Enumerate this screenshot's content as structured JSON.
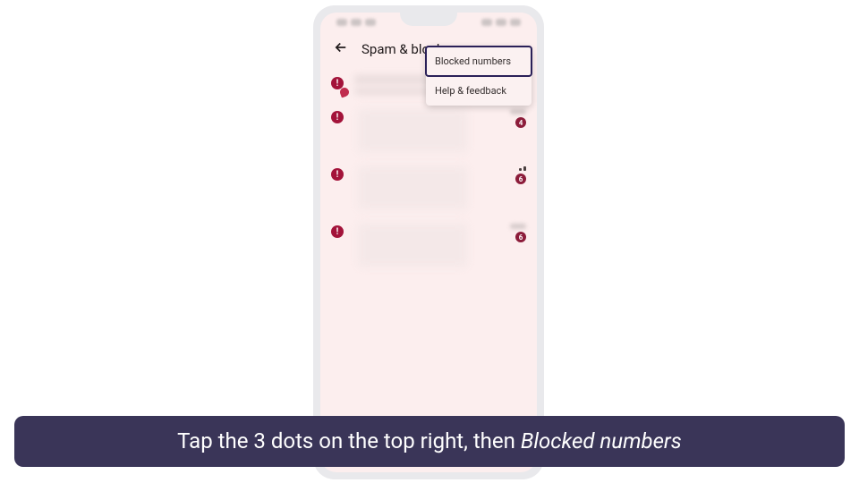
{
  "header": {
    "title": "Spam & block"
  },
  "dropdown": {
    "items": [
      {
        "label": "Blocked numbers",
        "highlighted": true
      },
      {
        "label": "Help & feedback",
        "highlighted": false
      }
    ]
  },
  "list": {
    "items": [
      {
        "has_bubble": true,
        "style": "lines",
        "count": "",
        "signal": false
      },
      {
        "has_bubble": false,
        "style": "block",
        "count": "4",
        "signal": false
      },
      {
        "has_bubble": false,
        "style": "block",
        "count": "6",
        "signal": true
      },
      {
        "has_bubble": false,
        "style": "block",
        "count": "6",
        "signal": false
      }
    ]
  },
  "caption": {
    "prefix": "Tap the 3 dots on the top right, then ",
    "emphasis": "Blocked numbers"
  }
}
